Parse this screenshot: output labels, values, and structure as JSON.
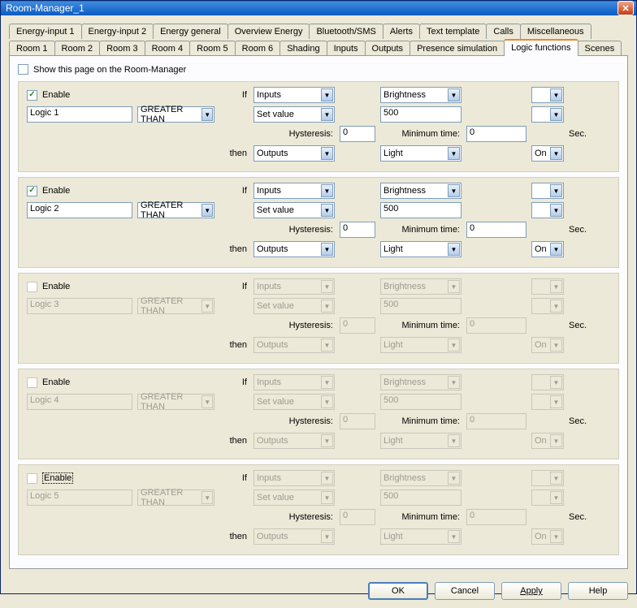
{
  "window": {
    "title": "Room-Manager_1"
  },
  "tabs_row1": [
    "Energy-input 1",
    "Energy-input 2",
    "Energy general",
    "Overview Energy",
    "Bluetooth/SMS",
    "Alerts",
    "Text template",
    "Calls",
    "Miscellaneous"
  ],
  "tabs_row2": [
    "Room 1",
    "Room 2",
    "Room 3",
    "Room 4",
    "Room 5",
    "Room 6",
    "Shading",
    "Inputs",
    "Outputs",
    "Presence simulation",
    "Logic functions",
    "Scenes"
  ],
  "active_tab": "Logic functions",
  "showpage_label": "Show this page on the Room-Manager",
  "showpage_checked": false,
  "labels": {
    "enable": "Enable",
    "if": "If",
    "then": "then",
    "hysteresis": "Hysteresis:",
    "minimum_time": "Minimum time:",
    "sec": "Sec."
  },
  "logics": [
    {
      "enabled": true,
      "name": "Logic 1",
      "op": "GREATER THAN",
      "if_src": "Inputs",
      "if_prop": "Brightness",
      "setvalue_mode": "Set value",
      "setvalue": "500",
      "hysteresis": "0",
      "mintime": "0",
      "then_tgt": "Outputs",
      "then_prop": "Light",
      "then_val": "On"
    },
    {
      "enabled": true,
      "name": "Logic 2",
      "op": "GREATER THAN",
      "if_src": "Inputs",
      "if_prop": "Brightness",
      "setvalue_mode": "Set value",
      "setvalue": "500",
      "hysteresis": "0",
      "mintime": "0",
      "then_tgt": "Outputs",
      "then_prop": "Light",
      "then_val": "On"
    },
    {
      "enabled": false,
      "name": "Logic 3",
      "op": "GREATER THAN",
      "if_src": "Inputs",
      "if_prop": "Brightness",
      "setvalue_mode": "Set value",
      "setvalue": "500",
      "hysteresis": "0",
      "mintime": "0",
      "then_tgt": "Outputs",
      "then_prop": "Light",
      "then_val": "On"
    },
    {
      "enabled": false,
      "name": "Logic 4",
      "op": "GREATER THAN",
      "if_src": "Inputs",
      "if_prop": "Brightness",
      "setvalue_mode": "Set value",
      "setvalue": "500",
      "hysteresis": "0",
      "mintime": "0",
      "then_tgt": "Outputs",
      "then_prop": "Light",
      "then_val": "On"
    },
    {
      "enabled": false,
      "name": "Logic 5",
      "op": "GREATER THAN",
      "if_src": "Inputs",
      "if_prop": "Brightness",
      "setvalue_mode": "Set value",
      "setvalue": "500",
      "hysteresis": "0",
      "mintime": "0",
      "then_tgt": "Outputs",
      "then_prop": "Light",
      "then_val": "On"
    }
  ],
  "buttons": {
    "ok": "OK",
    "cancel": "Cancel",
    "apply": "Apply",
    "help": "Help"
  }
}
